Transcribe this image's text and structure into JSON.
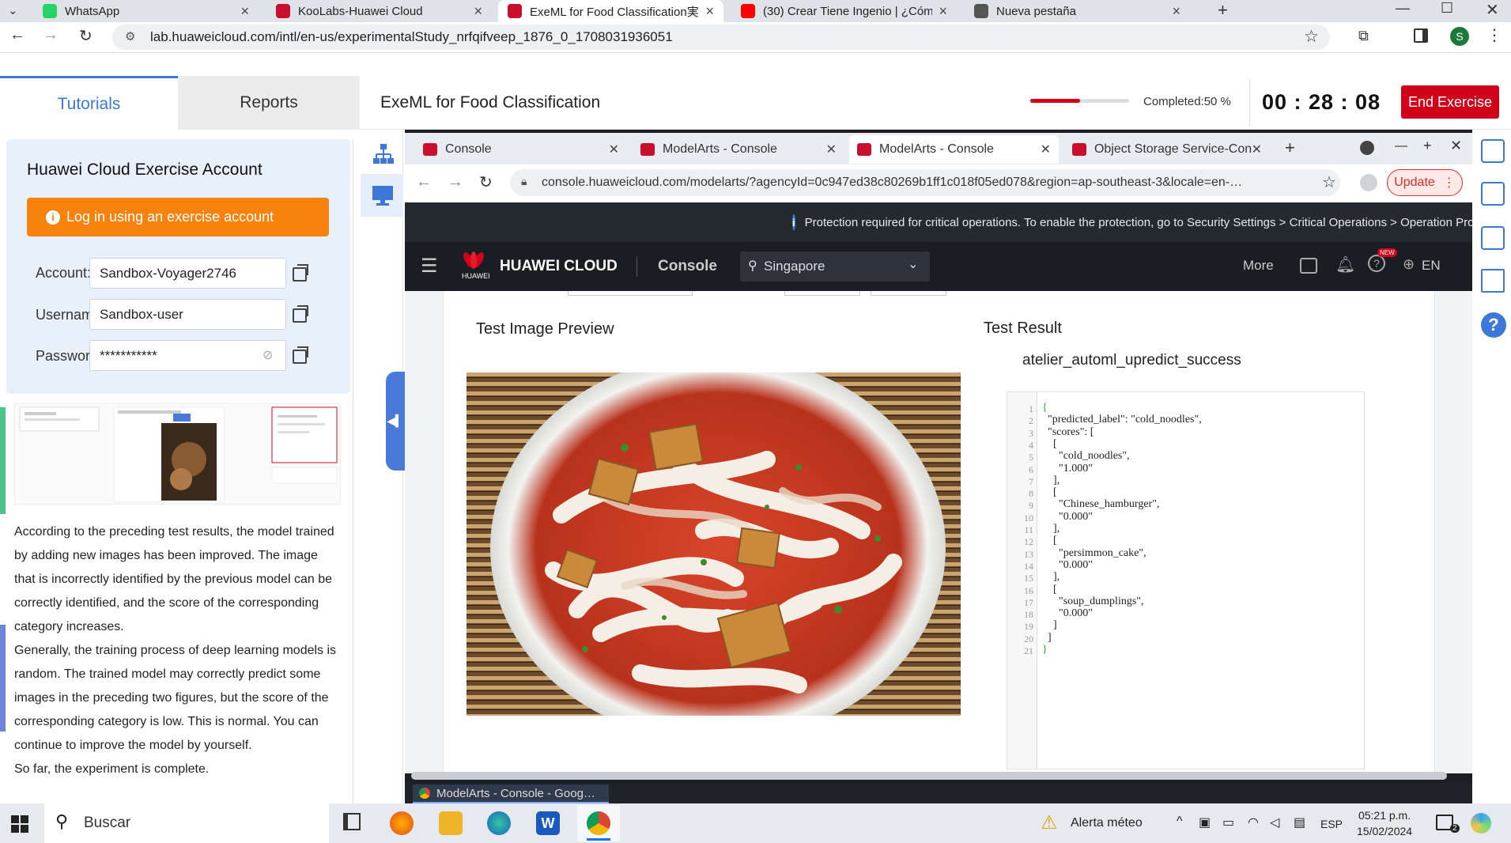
{
  "browser": {
    "tabs": [
      {
        "label": "WhatsApp",
        "icon": "whatsapp-icon",
        "color": "#25d366"
      },
      {
        "label": "KooLabs-Huawei Cloud",
        "icon": "huawei-icon",
        "color": "#c8102e"
      },
      {
        "label": "ExeML for Food Classification実",
        "icon": "huawei-icon",
        "color": "#c8102e"
      },
      {
        "label": "(30) Crear Tiene Ingenio | ¿Cóm",
        "icon": "youtube-icon",
        "color": "#ff0000"
      },
      {
        "label": "Nueva pestaña",
        "icon": "chrome-icon",
        "color": "#555555"
      }
    ],
    "active_tab": 2,
    "url": "lab.huaweicloud.com/intl/en-us/experimentalStudy_nrfqifveep_1876_0_1708031936051",
    "profile_initial": "S"
  },
  "lab": {
    "tabs": [
      "Tutorials",
      "Reports"
    ],
    "title": "ExeML for Food Classification",
    "progress": 0.5,
    "completed_label": "Completed:50 %",
    "timer": "00 : 28 : 08",
    "end_button": "End Exercise"
  },
  "account": {
    "title": "Huawei Cloud Exercise Account",
    "login_button": "Log in using an exercise account",
    "fields": [
      {
        "label": "Account:",
        "value": "Sandbox-Voyager2746"
      },
      {
        "label": "Usernam",
        "value": "Sandbox-user"
      },
      {
        "label": "Passwor",
        "value": "***********"
      }
    ]
  },
  "tutorial": {
    "paragraphs": [
      "According to the preceding test results, the model trained by adding new images has been improved. The image that is incorrectly identified by the previous model can be correctly identified, and the score of the corresponding category increases.",
      "Generally, the training process of deep learning models is random. The trained model may correctly predict some images in the preceding two figures, but the score of the corresponding category is low. This is normal. You can continue to improve the model by yourself.",
      "So far, the experiment is complete."
    ]
  },
  "vm_browser": {
    "tabs": [
      "Console",
      "ModelArts - Console",
      "ModelArts - Console",
      "Object Storage Service-Con"
    ],
    "active_tab": 2,
    "url": "console.huaweicloud.com/modelarts/?agencyId=0c947ed38c80269b1ff1c018f05ed078&region=ap-southeast-3&locale=en-…",
    "update_button": "Update",
    "protection_notice": "Protection required for critical operations. To enable the protection, go to Security Settings > Critical Operations > Operation Protectio"
  },
  "console": {
    "brand": "HUAWEI CLOUD",
    "brand_small": "HUAWEI",
    "console_label": "Console",
    "region": "Singapore",
    "more_label": "More",
    "lang": "EN",
    "badge": "NEW"
  },
  "test": {
    "preview_title": "Test Image Preview",
    "result_title": "Test Result",
    "result_status": "atelier_automl_upredict_success",
    "code_lines": [
      "{",
      "  \"predicted_label\": \"cold_noodles\",",
      "  \"scores\": [",
      "    [",
      "      \"cold_noodles\",",
      "      \"1.000\"",
      "    ],",
      "    [",
      "      \"Chinese_hamburger\",",
      "      \"0.000\"",
      "    ],",
      "    [",
      "      \"persimmon_cake\",",
      "      \"0.000\"",
      "    ],",
      "    [",
      "      \"soup_dumplings\",",
      "      \"0.000\"",
      "    ]",
      "  ]",
      "}"
    ]
  },
  "vm_taskbar": {
    "item": "ModelArts - Console - Goog…"
  },
  "taskbar": {
    "search": "Buscar",
    "weather": "Alerta méteo",
    "lang": "ESP",
    "time": "05:21 p.m.",
    "date": "15/02/2024",
    "notif_count": "2"
  }
}
